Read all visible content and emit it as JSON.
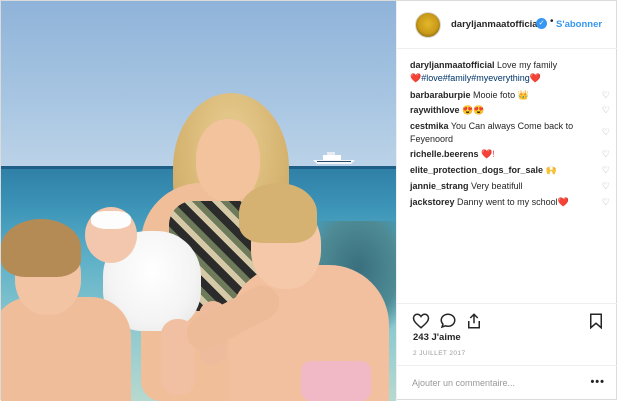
{
  "post": {
    "username": "daryljanmaatofficial",
    "follow_separator": "•",
    "follow_label": "S'abonner",
    "caption": {
      "text": "Love my family",
      "tags": [
        "#love",
        "#family",
        "#myeverything"
      ]
    },
    "comments": [
      {
        "user": "barbaraburpie",
        "text": "Mooie foto",
        "emoji": "👑"
      },
      {
        "user": "raywithlove",
        "text": "",
        "emoji": "😍😍"
      },
      {
        "user": "cestmika",
        "text": "You Can always Come back to Feyenoord",
        "emoji": ""
      },
      {
        "user": "richelle.beerens",
        "text": "",
        "emoji": "❤️!"
      },
      {
        "user": "elite_protection_dogs_for_sale",
        "text": "",
        "emoji": "🙌"
      },
      {
        "user": "jannie_strang",
        "text": "Very beatifull",
        "emoji": ""
      },
      {
        "user": "jackstorey",
        "text": "Danny went to my school",
        "emoji": "❤️"
      }
    ],
    "likes_label": "243 J'aime",
    "date": "2 JUILLET 2017",
    "comment_placeholder": "Ajouter un commentaire...",
    "more_label": "•••"
  },
  "colors": {
    "link_blue": "#3897f0",
    "heart_red": "#ed4956",
    "border": "#efefef"
  },
  "icons": [
    "verified-badge-icon",
    "heart-icon",
    "comment-icon",
    "share-icon",
    "bookmark-icon",
    "small-heart-icon"
  ]
}
